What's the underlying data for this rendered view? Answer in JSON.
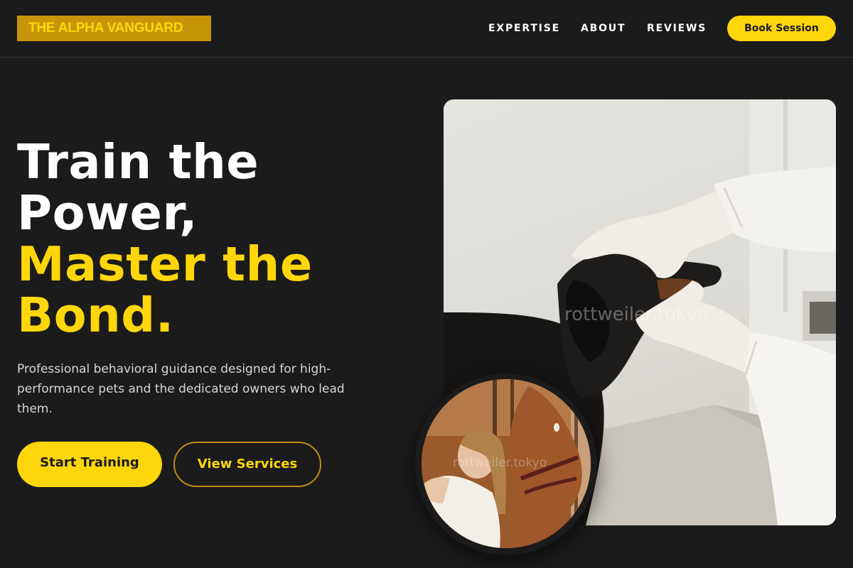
{
  "header": {
    "logo": "THE ALPHA VANGUARD",
    "nav": [
      "EXPERTISE",
      "ABOUT",
      "REVIEWS"
    ],
    "cta": "Book Session"
  },
  "hero": {
    "title_lines": [
      "Train the",
      "Power,"
    ],
    "accent_lines": [
      "Master the",
      "Bond."
    ],
    "description": "Professional behavioral guidance designed for high-performance pets and the dedicated owners who lead them.",
    "primary_button": "Start Training",
    "secondary_button": "View Services"
  },
  "images": {
    "main_watermark": "rottweiler.tokyo",
    "circle_watermark": "rottweiler.tokyo"
  },
  "colors": {
    "background": "#1b1b1c",
    "accent": "#ffd60a",
    "logo_bg": "#c8950a",
    "text": "#ffffff"
  }
}
